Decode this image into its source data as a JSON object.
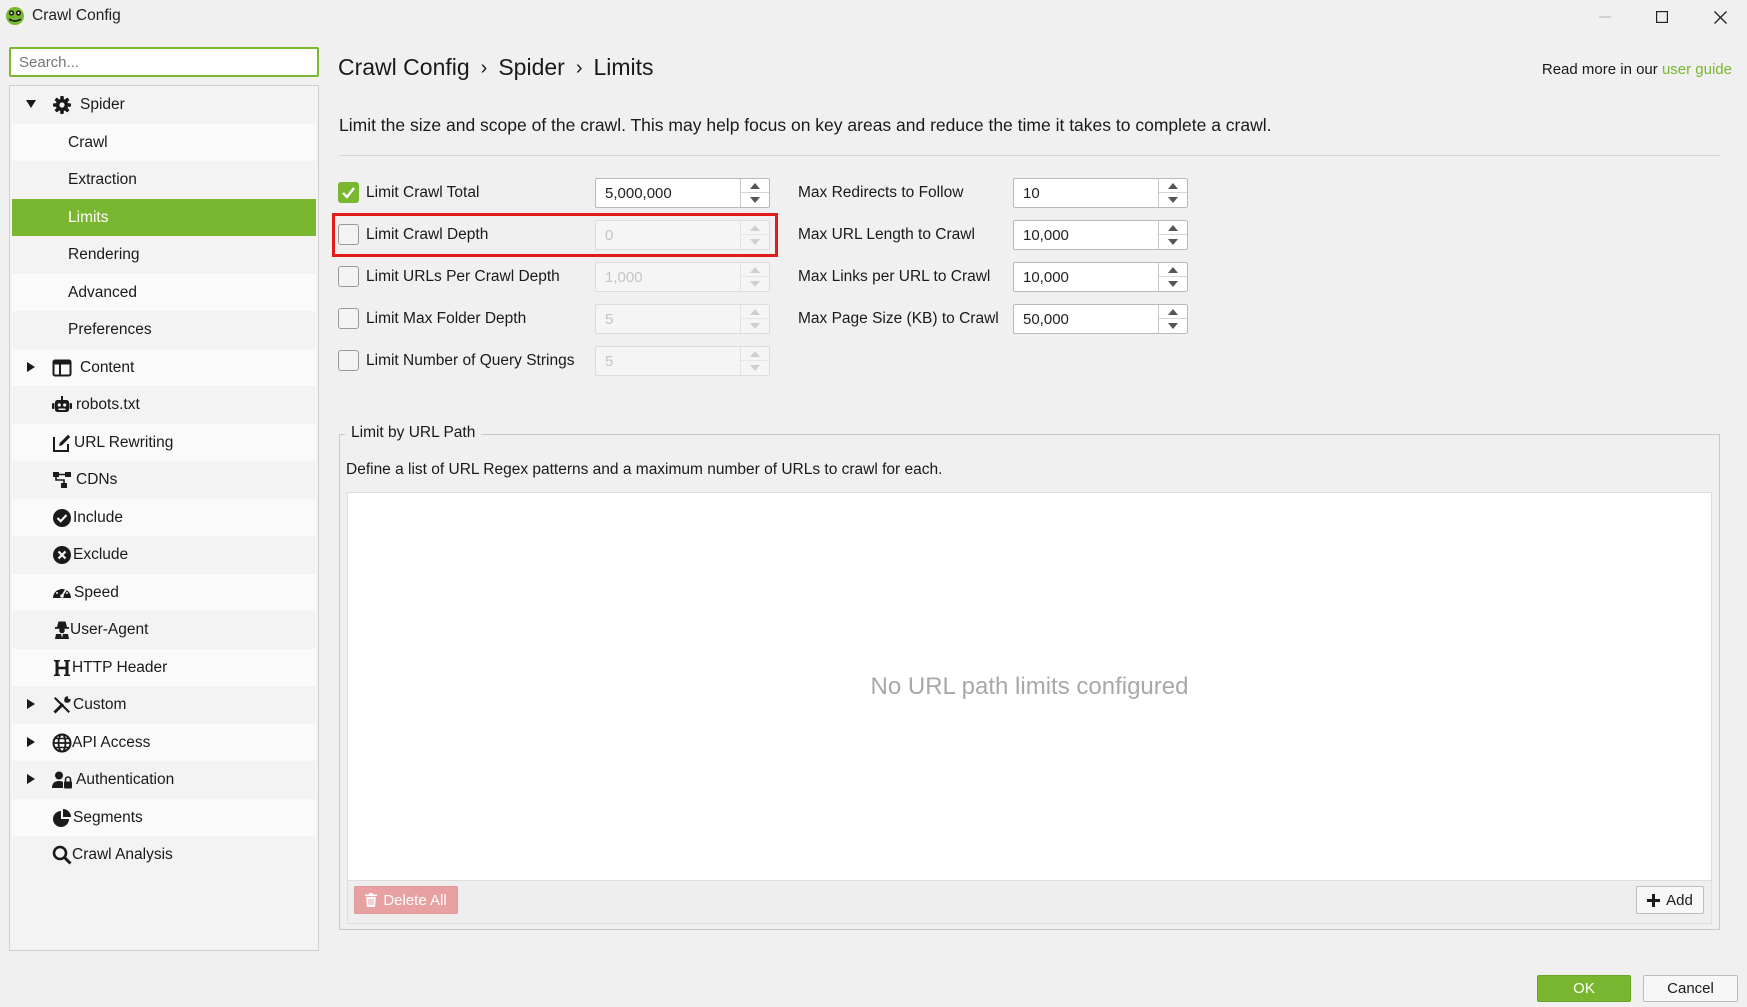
{
  "window": {
    "title": "Crawl Config",
    "icon": "frog-logo-icon",
    "controls": {
      "minimize_icon": "minimize-icon",
      "maximize_icon": "maximize-icon",
      "close_icon": "close-icon"
    }
  },
  "sidebar": {
    "search_placeholder": "Search...",
    "items": [
      {
        "label": "Spider",
        "icon": "gear-icon",
        "expandable": true,
        "expanded": true,
        "level": 0
      },
      {
        "label": "Crawl",
        "level": 1
      },
      {
        "label": "Extraction",
        "level": 1
      },
      {
        "label": "Limits",
        "level": 1,
        "active": true
      },
      {
        "label": "Rendering",
        "level": 1
      },
      {
        "label": "Advanced",
        "level": 1
      },
      {
        "label": "Preferences",
        "level": 1
      },
      {
        "label": "Content",
        "icon": "table-icon",
        "expandable": true,
        "expanded": false,
        "level": 0
      },
      {
        "label": "robots.txt",
        "icon": "robot-icon",
        "level": 0
      },
      {
        "label": "URL Rewriting",
        "icon": "edit-icon",
        "level": 0
      },
      {
        "label": "CDNs",
        "icon": "network-icon",
        "level": 0
      },
      {
        "label": "Include",
        "icon": "check-circle-icon",
        "level": 0
      },
      {
        "label": "Exclude",
        "icon": "x-circle-icon",
        "level": 0
      },
      {
        "label": "Speed",
        "icon": "speedometer-icon",
        "level": 0
      },
      {
        "label": "User-Agent",
        "icon": "user-secret-icon",
        "level": 0
      },
      {
        "label": "HTTP Header",
        "icon": "header-h-icon",
        "level": 0
      },
      {
        "label": "Custom",
        "icon": "tools-icon",
        "expandable": true,
        "expanded": false,
        "level": 0
      },
      {
        "label": "API Access",
        "icon": "globe-icon",
        "expandable": true,
        "expanded": false,
        "level": 0
      },
      {
        "label": "Authentication",
        "icon": "user-lock-icon",
        "expandable": true,
        "expanded": false,
        "level": 0
      },
      {
        "label": "Segments",
        "icon": "pie-chart-icon",
        "level": 0
      },
      {
        "label": "Crawl Analysis",
        "icon": "search-icon",
        "level": 0
      }
    ]
  },
  "header": {
    "breadcrumb": [
      "Crawl Config",
      "Spider",
      "Limits"
    ],
    "breadcrumb_separator": "›",
    "readmore_prefix": "Read more in our ",
    "readmore_link": "user guide",
    "description": "Limit the size and scope of the crawl. This may help focus on key areas and reduce the time it takes to complete a crawl."
  },
  "limits_left": [
    {
      "label": "Limit Crawl Total",
      "checked": true,
      "value": "5,000,000"
    },
    {
      "label": "Limit Crawl Depth",
      "checked": false,
      "value": "0",
      "highlighted": true
    },
    {
      "label": "Limit URLs Per Crawl Depth",
      "checked": false,
      "value": "1,000"
    },
    {
      "label": "Limit Max Folder Depth",
      "checked": false,
      "value": "5"
    },
    {
      "label": "Limit Number of Query Strings",
      "checked": false,
      "value": "5"
    }
  ],
  "limits_right": [
    {
      "label": "Max Redirects to Follow",
      "value": "10"
    },
    {
      "label": "Max URL Length to Crawl",
      "value": "10,000"
    },
    {
      "label": "Max Links per URL to Crawl",
      "value": "10,000"
    },
    {
      "label": "Max Page Size (KB) to Crawl",
      "value": "50,000"
    }
  ],
  "url_path": {
    "title": "Limit by URL Path",
    "description": "Define a list of URL Regex patterns and a maximum number of URLs to crawl for each.",
    "empty_message": "No URL path limits configured",
    "delete_all_label": "Delete All",
    "add_label": "Add"
  },
  "footer": {
    "ok_label": "OK",
    "cancel_label": "Cancel"
  },
  "colors": {
    "accent": "#79b730",
    "highlight": "#e21b1b",
    "delete": "#e8a1a1"
  }
}
